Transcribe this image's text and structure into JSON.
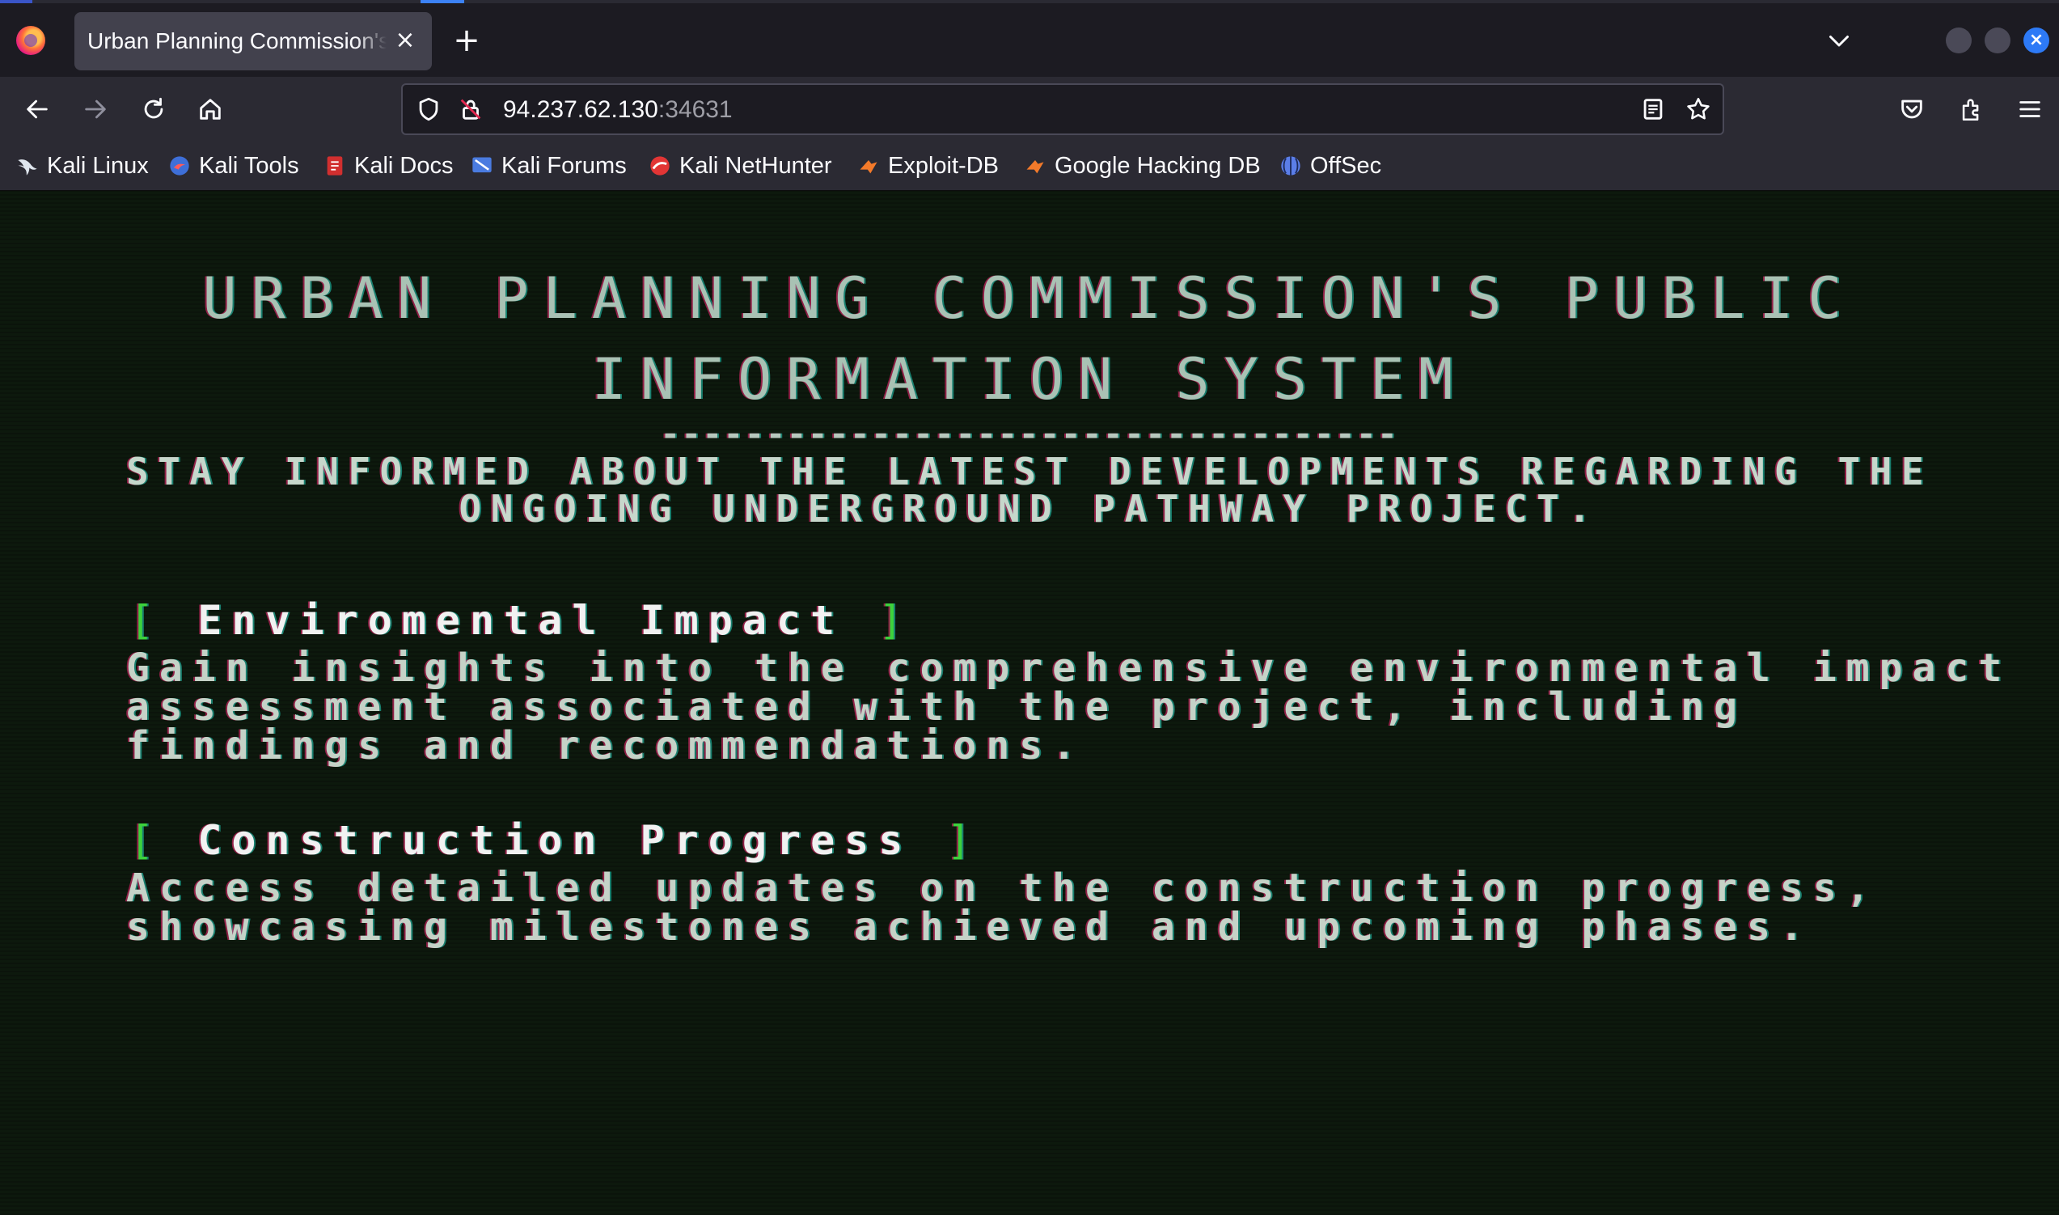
{
  "browser": {
    "tab": {
      "title": "Urban Planning Commission's Public Information System",
      "close_label": "×"
    },
    "new_tab_label": "+",
    "window_close_label": "×",
    "url": {
      "host": "94.237.62.130",
      "port": ":34631"
    },
    "bookmarks": [
      {
        "label": "Kali Linux",
        "icon": "kali-dragon-icon"
      },
      {
        "label": "Kali Tools",
        "icon": "kali-tools-icon"
      },
      {
        "label": "Kali Docs",
        "icon": "kali-docs-icon"
      },
      {
        "label": "Kali Forums",
        "icon": "kali-forums-icon"
      },
      {
        "label": "Kali NetHunter",
        "icon": "kali-nethunter-icon"
      },
      {
        "label": "Exploit-DB",
        "icon": "exploit-db-icon"
      },
      {
        "label": "Google Hacking DB",
        "icon": "ghdb-icon"
      },
      {
        "label": "OffSec",
        "icon": "offsec-icon"
      }
    ],
    "colors": {
      "accent": "#2d7af6",
      "chrome": "#2b2a33",
      "tabbar": "#1c1b22"
    }
  },
  "page": {
    "title_line1": "URBAN PLANNING COMMISSION'S PUBLIC",
    "title_line2": "INFORMATION SYSTEM",
    "divider": "-----------------------------------",
    "subtitle_line1": "STAY INFORMED ABOUT THE LATEST DEVELOPMENTS REGARDING THE",
    "subtitle_line2": "ONGOING UNDERGROUND PATHWAY PROJECT.",
    "bracket_open": "[",
    "bracket_close": "]",
    "sections": [
      {
        "heading": "Enviromental Impact",
        "lines": [
          "Gain insights into the comprehensive environmental impact",
          "assessment associated with the project, including",
          "findings and recommendations."
        ]
      },
      {
        "heading": "Construction Progress",
        "lines": [
          "Access detailed updates on the construction progress,",
          "showcasing milestones achieved and upcoming phases."
        ]
      }
    ],
    "colors": {
      "background": "#0d190d",
      "bracket": "#3cd23c",
      "text": "#c5d2c7"
    }
  }
}
